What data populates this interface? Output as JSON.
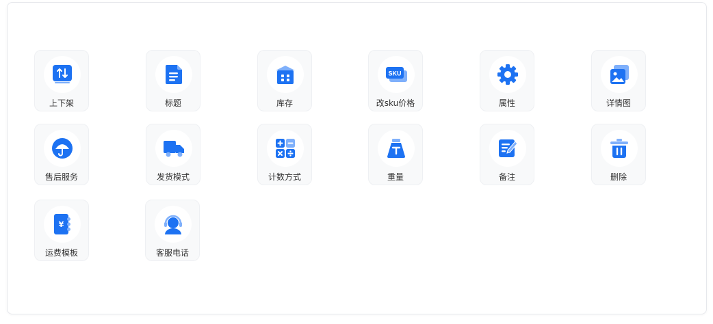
{
  "accent_color": "#1d72f2",
  "accent_light": "#7fb0fb",
  "grid": {
    "items": [
      {
        "label": "上下架",
        "icon": "updown-arrows-icon"
      },
      {
        "label": "标题",
        "icon": "document-icon"
      },
      {
        "label": "库存",
        "icon": "warehouse-icon"
      },
      {
        "label": "改sku价格",
        "icon": "sku-icon"
      },
      {
        "label": "属性",
        "icon": "gear-icon"
      },
      {
        "label": "详情图",
        "icon": "images-icon"
      },
      {
        "label": "售后服务",
        "icon": "umbrella-icon"
      },
      {
        "label": "发货模式",
        "icon": "truck-icon"
      },
      {
        "label": "计数方式",
        "icon": "calculator-icon"
      },
      {
        "label": "重量",
        "icon": "weight-icon"
      },
      {
        "label": "备注",
        "icon": "note-edit-icon"
      },
      {
        "label": "删除",
        "icon": "trash-icon"
      },
      {
        "label": "运费模板",
        "icon": "yen-notebook-icon"
      },
      {
        "label": "客服电话",
        "icon": "customer-service-icon"
      }
    ]
  }
}
